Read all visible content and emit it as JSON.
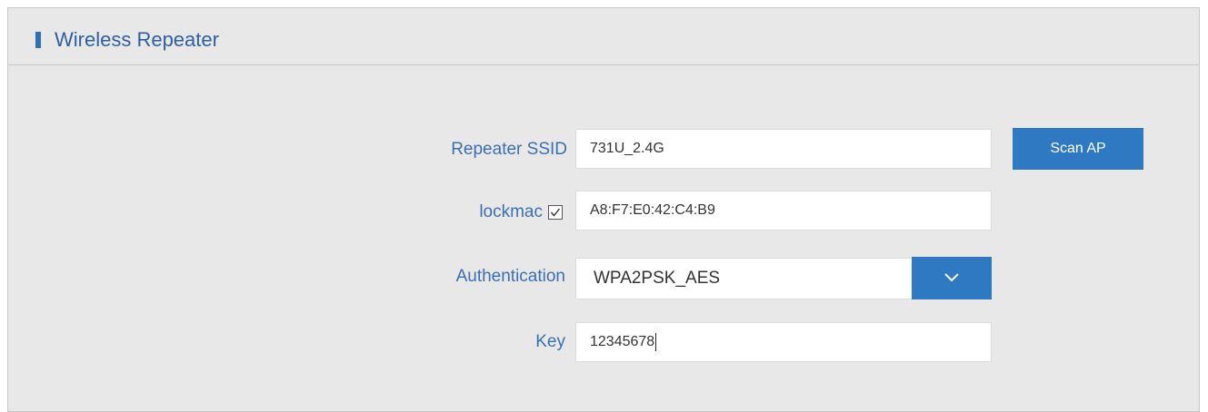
{
  "section": {
    "title": "Wireless Repeater"
  },
  "form": {
    "ssid_label": "Repeater SSID",
    "ssid_value": "731U_2.4G",
    "scan_button": "Scan AP",
    "lockmac_label": "lockmac",
    "lockmac_checked": true,
    "lockmac_value": "A8:F7:E0:42:C4:B9",
    "auth_label": "Authentication",
    "auth_value": "WPA2PSK_AES",
    "key_label": "Key",
    "key_value": "12345678"
  },
  "colors": {
    "accent": "#2f79c2",
    "label": "#3b6fb3",
    "panel_bg": "#e9e8e8"
  },
  "icons": {
    "header_marker": "section-marker-bar",
    "lockmac_checkbox": "checkbox-checked-icon",
    "auth_dropdown": "chevron-down-icon"
  }
}
